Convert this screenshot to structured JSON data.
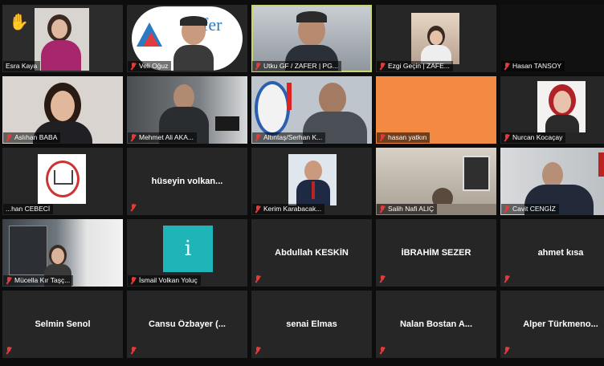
{
  "accent": {
    "selected_border": "#c8d66a",
    "muted_mic": "#e23b3b",
    "tile_bg": "#262626",
    "orange_tile": "#f38a44"
  },
  "tiles": [
    {
      "name": "Esra Kaya",
      "muted": false,
      "video": true,
      "hand_raised": true
    },
    {
      "name": "Veli Oğuz",
      "muted": true,
      "video": true,
      "logo_text": "ZAFER"
    },
    {
      "name": "Utku GF / ZAFER | PG...",
      "muted": true,
      "video": true,
      "selected": true
    },
    {
      "name": "Ezgi Geçin | ZAFE...",
      "muted": true,
      "video": true
    },
    {
      "name": "Hasan TANSOY",
      "muted": true,
      "video": false
    },
    {
      "name": "Aslıhan BABA",
      "muted": true,
      "video": true
    },
    {
      "name": "Mehmet Ali AKA...",
      "muted": true,
      "video": true
    },
    {
      "name": "Altıntaş/Serhan K...",
      "muted": true,
      "video": true
    },
    {
      "name": "hasan yatkın",
      "muted": true,
      "video": false
    },
    {
      "name": "Nurcan Kocaçay",
      "muted": true,
      "video": true
    },
    {
      "name": "...han CEBECİ",
      "muted": false,
      "video": true
    },
    {
      "name": "hüseyin volkan...",
      "muted": true,
      "video": false,
      "centered": true
    },
    {
      "name": "Kerim Karabacak...",
      "muted": true,
      "video": true
    },
    {
      "name": "Salih Nafi ALIÇ",
      "muted": true,
      "video": true
    },
    {
      "name": "Cavit CENGİZ",
      "muted": true,
      "video": true
    },
    {
      "name": "Mücella Kır Taşç...",
      "muted": true,
      "video": true
    },
    {
      "name": "İsmail Volkan Yoluç",
      "muted": true,
      "video": false,
      "avatar_letter": "i"
    },
    {
      "name": "Abdullah KESKİN",
      "muted": true,
      "video": false,
      "centered": true
    },
    {
      "name": "İBRAHİM SEZER",
      "muted": true,
      "video": false,
      "centered": true
    },
    {
      "name": "ahmet kısa",
      "muted": true,
      "video": false,
      "centered": true
    },
    {
      "name": "Selmin Senol",
      "muted": true,
      "video": false,
      "centered": true
    },
    {
      "name": "Cansu Özbayer (...",
      "muted": true,
      "video": false,
      "centered": true
    },
    {
      "name": "senai Elmas",
      "muted": true,
      "video": false,
      "centered": true
    },
    {
      "name": "Nalan Bostan A...",
      "muted": true,
      "video": false,
      "centered": true
    },
    {
      "name": "Alper Türkmeno...",
      "muted": true,
      "video": false,
      "centered": true
    }
  ]
}
